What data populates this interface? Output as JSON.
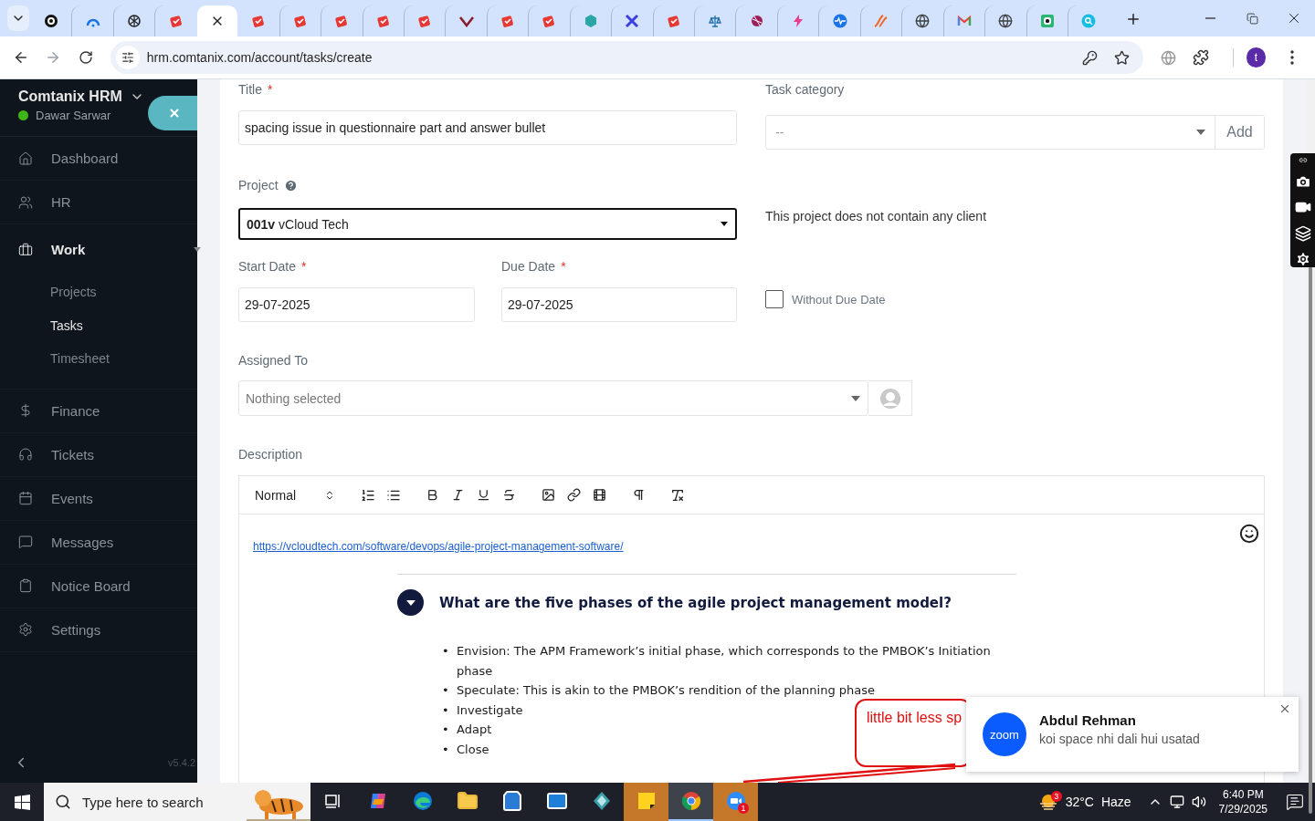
{
  "browser": {
    "tabs": [
      {
        "kind": "target",
        "selected": false
      },
      {
        "kind": "arc",
        "selected": false
      },
      {
        "kind": "knot",
        "selected": false
      },
      {
        "kind": "clipboard",
        "selected": false
      },
      {
        "selected": true
      },
      {
        "kind": "clipboard",
        "selected": false
      },
      {
        "kind": "clipboard",
        "selected": false
      },
      {
        "kind": "clipboard",
        "selected": false
      },
      {
        "kind": "clipboard",
        "selected": false
      },
      {
        "kind": "clipboard",
        "selected": false
      },
      {
        "kind": "check",
        "selected": false
      },
      {
        "kind": "clipboard",
        "selected": false
      },
      {
        "kind": "clipboard",
        "selected": false
      },
      {
        "kind": "hexagon",
        "selected": false
      },
      {
        "kind": "cross",
        "selected": false
      },
      {
        "kind": "clipboard",
        "selected": false
      },
      {
        "kind": "scale",
        "selected": false
      },
      {
        "kind": "ball",
        "selected": false
      },
      {
        "kind": "bolt",
        "selected": false
      },
      {
        "kind": "pulse",
        "selected": false
      },
      {
        "kind": "wave",
        "selected": false
      },
      {
        "kind": "globe",
        "selected": false
      },
      {
        "kind": "mail",
        "selected": false
      },
      {
        "kind": "globe",
        "selected": false
      },
      {
        "kind": "square",
        "selected": false
      },
      {
        "kind": "search",
        "selected": false
      }
    ],
    "url": "hrm.comtanix.com/account/tasks/create",
    "profile_initial": "t"
  },
  "sidebar": {
    "brand": "Comtanix HRM",
    "user": "Dawar Sarwar",
    "online": true,
    "items": [
      {
        "kind": "home",
        "label": "Dashboard",
        "selected": false
      },
      {
        "kind": "users",
        "label": "HR",
        "selected": false
      },
      {
        "kind": "briefcase",
        "label": "Work",
        "selected": true,
        "expanded": true,
        "children": [
          {
            "label": "Projects",
            "selected": false
          },
          {
            "label": "Tasks",
            "selected": true
          },
          {
            "label": "Timesheet",
            "selected": false
          }
        ]
      },
      {
        "kind": "dollar",
        "label": "Finance",
        "selected": false
      },
      {
        "kind": "headset",
        "label": "Tickets",
        "selected": false
      },
      {
        "kind": "calendar",
        "label": "Events",
        "selected": false
      },
      {
        "kind": "messages",
        "label": "Messages",
        "selected": false
      },
      {
        "kind": "clipboard",
        "label": "Notice Board",
        "selected": false
      },
      {
        "kind": "gear",
        "label": "Settings",
        "selected": false
      }
    ],
    "version": "v5.4.2"
  },
  "form": {
    "title": {
      "label": "Title",
      "required_mark": "*",
      "value": "spacing issue in questionnaire part and answer bullet"
    },
    "task_category": {
      "label": "Task category",
      "value": "--",
      "button": "Add"
    },
    "project": {
      "label": "Project",
      "help": true,
      "focused": true,
      "value": "**001v** vCloud Tech",
      "note": "This project does not contain any client"
    },
    "start_date": {
      "label": "Start Date",
      "required_mark": "*",
      "value": "29-07-2025"
    },
    "due_date": {
      "label": "Due Date",
      "required_mark": "*",
      "value": "29-07-2025"
    },
    "without_due_date": {
      "label": "Without Due Date",
      "checked": false
    },
    "assigned_to": {
      "label": "Assigned To",
      "placeholder": "Nothing selected"
    },
    "description": {
      "label": "Description",
      "format": "Normal",
      "link": "https://vcloudtech.com/software/devops/agile-project-management-software/",
      "question": "What are the five phases of the agile project management model?",
      "bullet_marker": "•",
      "bullets": [
        "Envision: The APM Framework’s initial phase, which corresponds to the PMBOK’s Initiation phase",
        "Speculate: This is akin to the PMBOK’s rendition of the planning phase",
        "Investigate",
        "Adapt",
        "Close"
      ]
    }
  },
  "annotation": {
    "text": "little bit less sp"
  },
  "notification": {
    "logo_text": "zoom",
    "sender": "Abdul Rehman",
    "message": "koi space nhi dali hui usatad"
  },
  "taskbar": {
    "search_placeholder": "Type here to search",
    "apps": [
      {
        "kind": "taskview",
        "active": false,
        "flashing": false
      },
      {
        "kind": "copilot",
        "active": false,
        "flashing": false
      },
      {
        "kind": "edge",
        "active": false,
        "flashing": false
      },
      {
        "kind": "explorer",
        "active": false,
        "flashing": false
      },
      {
        "kind": "store",
        "active": false,
        "flashing": false
      },
      {
        "kind": "mail",
        "active": false,
        "flashing": false
      },
      {
        "kind": "gem",
        "active": false,
        "flashing": false
      },
      {
        "kind": "sticky",
        "active": false,
        "flashing": true
      },
      {
        "kind": "chrome",
        "active": true,
        "flashing": false
      },
      {
        "kind": "zoom",
        "active": false,
        "flashing": true,
        "badge": "1"
      }
    ],
    "weather": {
      "badge": "3",
      "temperature": "32°C",
      "condition": "Haze"
    },
    "time": "6:40 PM",
    "date": "7/29/2025"
  }
}
